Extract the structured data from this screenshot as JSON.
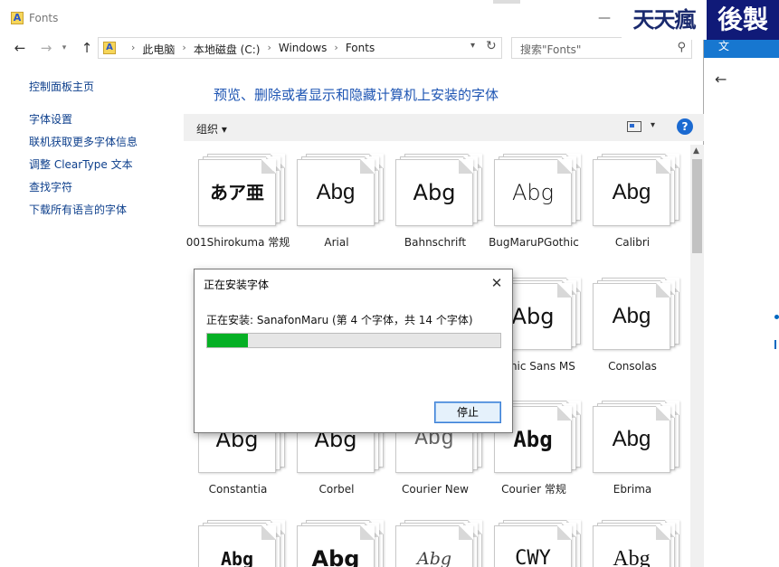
{
  "window": {
    "title": "Fonts"
  },
  "navigation": {
    "path": [
      "此电脑",
      "本地磁盘 (C:)",
      "Windows",
      "Fonts"
    ],
    "search_placeholder": "搜索\"Fonts\""
  },
  "sidebar": {
    "items": [
      {
        "label": "控制面板主页"
      },
      {
        "label": "字体设置"
      },
      {
        "label": "联机获取更多字体信息"
      },
      {
        "label": "调整 ClearType 文本"
      },
      {
        "label": "查找字符"
      },
      {
        "label": "下载所有语言的字体"
      }
    ]
  },
  "main": {
    "heading": "预览、删除或者显示和隐藏计算机上安装的字体",
    "toolbar": {
      "organize_label": "组织"
    }
  },
  "fonts": [
    {
      "sample": "あア亜",
      "name": "001Shirokuma 常规"
    },
    {
      "sample": "Abg",
      "name": "Arial"
    },
    {
      "sample": "Abg",
      "name": "Bahnschrift"
    },
    {
      "sample": "Abg",
      "name": "BugMaruPGothic"
    },
    {
      "sample": "Abg",
      "name": "Calibri"
    },
    {
      "sample": "",
      "name": ""
    },
    {
      "sample": "",
      "name": ""
    },
    {
      "sample": "",
      "name": ""
    },
    {
      "sample": "Abg",
      "name": "Comic Sans MS"
    },
    {
      "sample": "Abg",
      "name": "Consolas"
    },
    {
      "sample": "Abg",
      "name": "Constantia"
    },
    {
      "sample": "Abg",
      "name": "Corbel"
    },
    {
      "sample": "Abg",
      "name": "Courier New"
    },
    {
      "sample": "Abg",
      "name": "Courier 常规"
    },
    {
      "sample": "Abg",
      "name": "Ebrima"
    },
    {
      "sample": "Abg",
      "name": ""
    },
    {
      "sample": "Abg",
      "name": ""
    },
    {
      "sample": "Abg",
      "name": ""
    },
    {
      "sample": "CWY",
      "name": ""
    },
    {
      "sample": "Abg",
      "name": ""
    }
  ],
  "dialog": {
    "title": "正在安装字体",
    "status": "正在安装: SanafonMaru (第 4 个字体，共 14 个字体)",
    "progress": 0.14,
    "progress_color": "#06b025",
    "stop_label": "停止"
  },
  "watermark": {
    "left_text": "天天瘋",
    "right_text": "後製"
  },
  "background_window": {
    "title_fragment": "文"
  }
}
